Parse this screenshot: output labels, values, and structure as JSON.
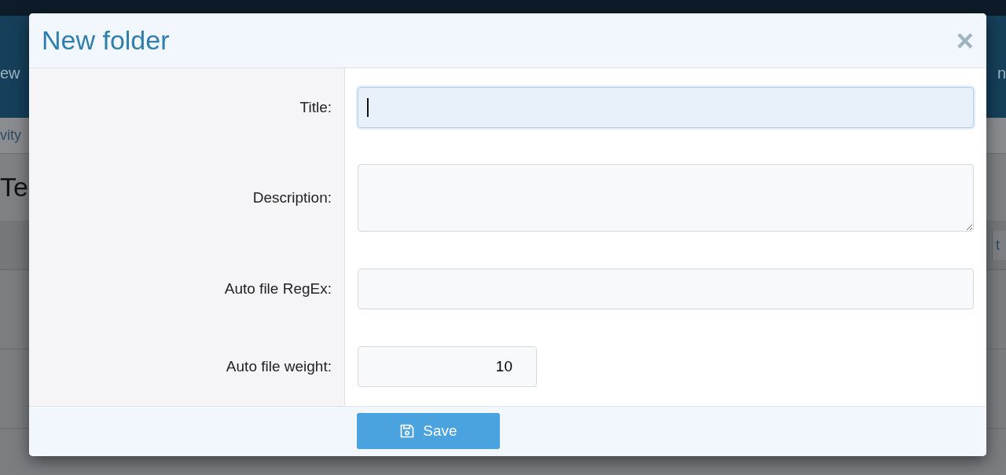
{
  "background": {
    "nav_left": "ew",
    "nav_right": "n",
    "subnav": "vity",
    "heading": "Te",
    "table_header_right": "t"
  },
  "dialog": {
    "title": "New folder",
    "close": "×",
    "fields": [
      {
        "label": "Title:",
        "kind": "input",
        "focused": true
      },
      {
        "label": "Description:",
        "kind": "textarea",
        "focused": false
      },
      {
        "label": "Auto file RegEx:",
        "kind": "input",
        "focused": false
      },
      {
        "label": "Auto file weight:",
        "kind": "number",
        "value": "10",
        "focused": false
      }
    ],
    "save": "Save"
  }
}
